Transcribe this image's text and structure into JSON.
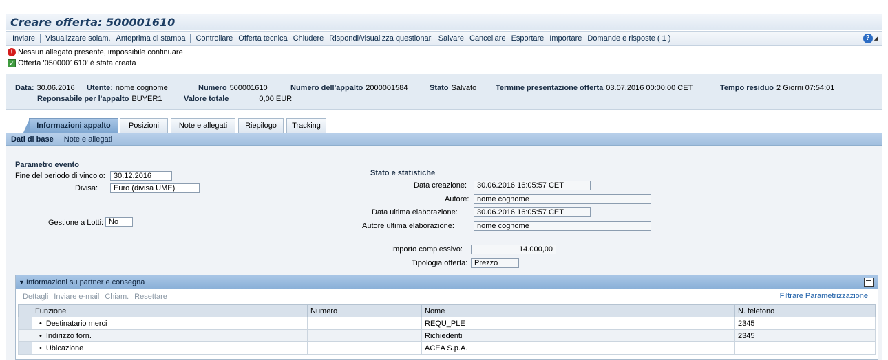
{
  "title": "Creare offerta: 500001610",
  "toolbar": {
    "items": [
      "Inviare",
      "|",
      "Visualizzare solam.",
      "Anteprima di stampa",
      "|",
      "Controllare",
      "Offerta tecnica",
      "Chiudere",
      "Rispondi/visualizza questionari",
      "Salvare",
      "Cancellare",
      "Esportare",
      "Importare",
      "Domande e risposte ( 1 )"
    ]
  },
  "messages": {
    "error": "Nessun allegato presente, impossibile continuare",
    "success": "Offerta '0500001610' è stata creata"
  },
  "header": {
    "data_label": "Data:",
    "data_value": "30.06.2016",
    "utente_label": "Utente:",
    "utente_value": "nome cognome",
    "numero_label": "Numero",
    "numero_value": "500001610",
    "appalto_label": "Numero dell'appalto",
    "appalto_value": "2000001584",
    "stato_label": "Stato",
    "stato_value": "Salvato",
    "termine_label": "Termine presentazione offerta",
    "termine_value": "03.07.2016 00:00:00 CET",
    "tempo_label": "Tempo residuo",
    "tempo_value": "2 Giorni 07:54:01",
    "resp_label": "Reponsabile per l'appalto",
    "resp_value": "BUYER1",
    "valore_label": "Valore totale",
    "valore_value": "0,00 EUR"
  },
  "tabs": [
    "Informazioni appalto",
    "Posizioni",
    "Note e allegati",
    "Riepilogo",
    "Tracking"
  ],
  "subtabs": [
    "Dati di base",
    "Note e allegati"
  ],
  "evento": {
    "title": "Parametro evento",
    "fine_label": "Fine del periodo di vincolo:",
    "fine_value": "30.12.2016",
    "divisa_label": "Divisa:",
    "divisa_value": "Euro (divisa UME)",
    "lotti_label": "Gestione a Lotti:",
    "lotti_value": "No"
  },
  "stato": {
    "title": "Stato e statistiche",
    "creazione_label": "Data creazione:",
    "creazione_value": "30.06.2016 16:05:57 CET",
    "autore_label": "Autore:",
    "autore_value": "nome cognome",
    "ultima_label": "Data ultima elaborazione:",
    "ultima_value": "30.06.2016 16:05:57 CET",
    "autore_ultima_label": "Autore ultima elaborazione:",
    "autore_ultima_value": "nome cognome",
    "importo_label": "Importo complessivo:",
    "importo_value": "14.000,00",
    "tipologia_label": "Tipologia offerta:",
    "tipologia_value": "Prezzo"
  },
  "partner": {
    "title": "Informazioni su partner e consegna",
    "actions": [
      "Dettagli",
      "Inviare e-mail",
      "Chiam.",
      "Resettare"
    ],
    "filter": "Filtrare Parametrizzazione",
    "columns": [
      "Funzione",
      "Numero",
      "Nome",
      "N. telefono"
    ],
    "rows": [
      {
        "funzione": "Destinatario merci",
        "numero": "",
        "nome": "REQU_PLE",
        "telefono": "2345"
      },
      {
        "funzione": "Indirizzo forn.",
        "numero": "",
        "nome": "Richiedenti",
        "telefono": "2345"
      },
      {
        "funzione": "Ubicazione",
        "numero": "",
        "nome": "ACEA S.p.A.",
        "telefono": ""
      }
    ]
  }
}
